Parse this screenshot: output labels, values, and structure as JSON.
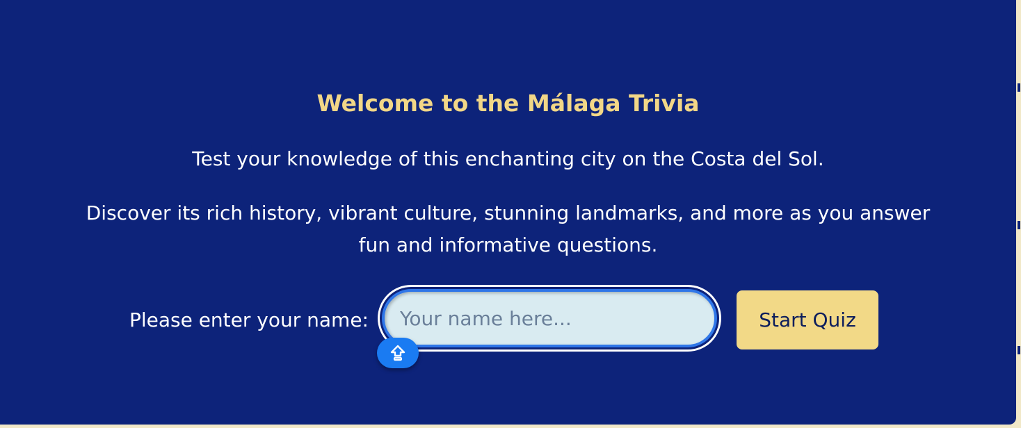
{
  "welcome": {
    "title": "Welcome to the Málaga Trivia",
    "intro": "Test your knowledge of this enchanting city on the Costa del Sol.",
    "description": "Discover its rich history, vibrant culture, stunning landmarks, and more as you answer fun and informative questions."
  },
  "form": {
    "name_label": "Please enter your name:",
    "name_placeholder": "Your name here...",
    "name_value": "",
    "start_label": "Start Quiz",
    "input_assist_icon": "arrow-up-in-box-icon"
  },
  "colors": {
    "background": "#0d237a",
    "title": "#f2d787",
    "text": "#ffffff",
    "button": "#f2d987",
    "input_background": "#d9ebf1",
    "focus_ring": "#2f76e8",
    "assist_badge": "#1a7bf2"
  }
}
